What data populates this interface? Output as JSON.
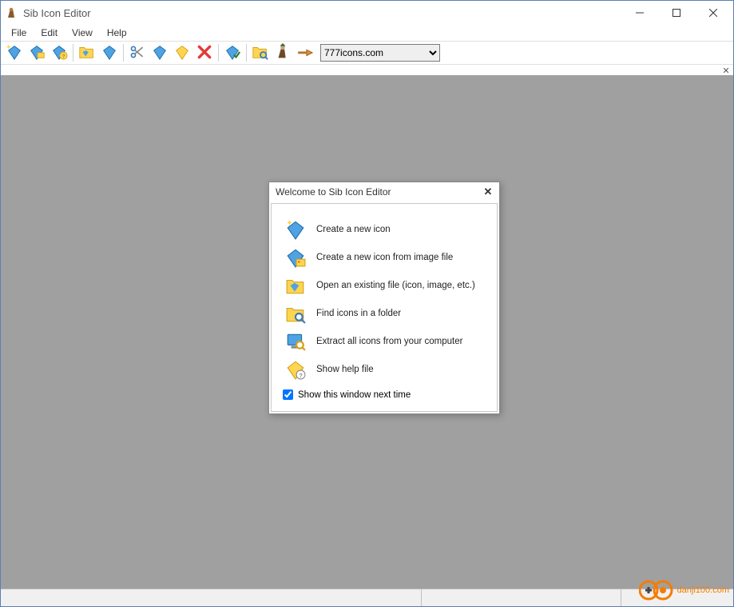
{
  "app": {
    "title": "Sib Icon Editor"
  },
  "menu": {
    "items": [
      "File",
      "Edit",
      "View",
      "Help"
    ]
  },
  "toolbar": {
    "dropdown_value": "777icons.com",
    "buttons": [
      {
        "name": "new-icon",
        "icon": "diamond-sparkle-icon"
      },
      {
        "name": "new-from-image-icon",
        "icon": "diamond-image-icon"
      },
      {
        "name": "open-icon-file",
        "icon": "diamond-question-icon"
      },
      {
        "name": "open-folder",
        "icon": "folder-open-icon"
      },
      {
        "name": "open-diamond",
        "icon": "diamond-icon"
      },
      {
        "name": "cut",
        "icon": "scissors-icon"
      },
      {
        "name": "copy-diamond",
        "icon": "diamond-blue-icon"
      },
      {
        "name": "paste-diamond",
        "icon": "diamond-yellow-icon"
      },
      {
        "name": "delete",
        "icon": "delete-x-icon"
      },
      {
        "name": "save-diamond",
        "icon": "diamond-check-icon"
      },
      {
        "name": "find-icons",
        "icon": "folder-search-icon"
      },
      {
        "name": "extract-icons",
        "icon": "wizard-icon"
      },
      {
        "name": "point",
        "icon": "hand-point-icon"
      }
    ]
  },
  "dialog": {
    "title": "Welcome to Sib Icon Editor",
    "items": [
      {
        "label": "Create a new icon",
        "icon": "diamond-sparkle-icon"
      },
      {
        "label": "Create a new icon from image file",
        "icon": "diamond-image-icon"
      },
      {
        "label": "Open an existing file (icon, image, etc.)",
        "icon": "folder-open-icon"
      },
      {
        "label": "Find icons in a folder",
        "icon": "folder-search-icon"
      },
      {
        "label": "Extract all icons from your computer",
        "icon": "computer-search-icon"
      },
      {
        "label": "Show help file",
        "icon": "diamond-help-icon"
      }
    ],
    "checkbox_label": "Show this window next time",
    "checkbox_checked": true
  },
  "watermark": {
    "text": "danji100.com"
  }
}
